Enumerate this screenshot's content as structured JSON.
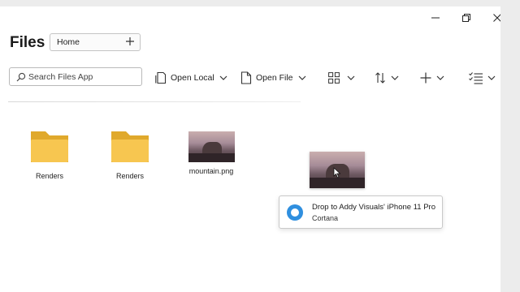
{
  "window": {
    "title": "Files",
    "controls": [
      "minimize-icon",
      "restore-icon",
      "close-icon"
    ]
  },
  "tabs": [
    {
      "label": "Home"
    }
  ],
  "search": {
    "placeholder": "Search Files App"
  },
  "toolbar": {
    "open_local": "Open Local",
    "open_file": "Open File"
  },
  "files": [
    {
      "name": "Renders",
      "type": "folder"
    },
    {
      "name": "Renders",
      "type": "folder"
    },
    {
      "name": "mountain.png",
      "type": "image"
    }
  ],
  "toast": {
    "title": "Drop to Addy Visuals' iPhone 11 Pro",
    "subtitle": "Cortana"
  },
  "colors": {
    "folder": "#f7c650",
    "folder_tab": "#e0a92c",
    "accent": "#2f8fdf"
  }
}
